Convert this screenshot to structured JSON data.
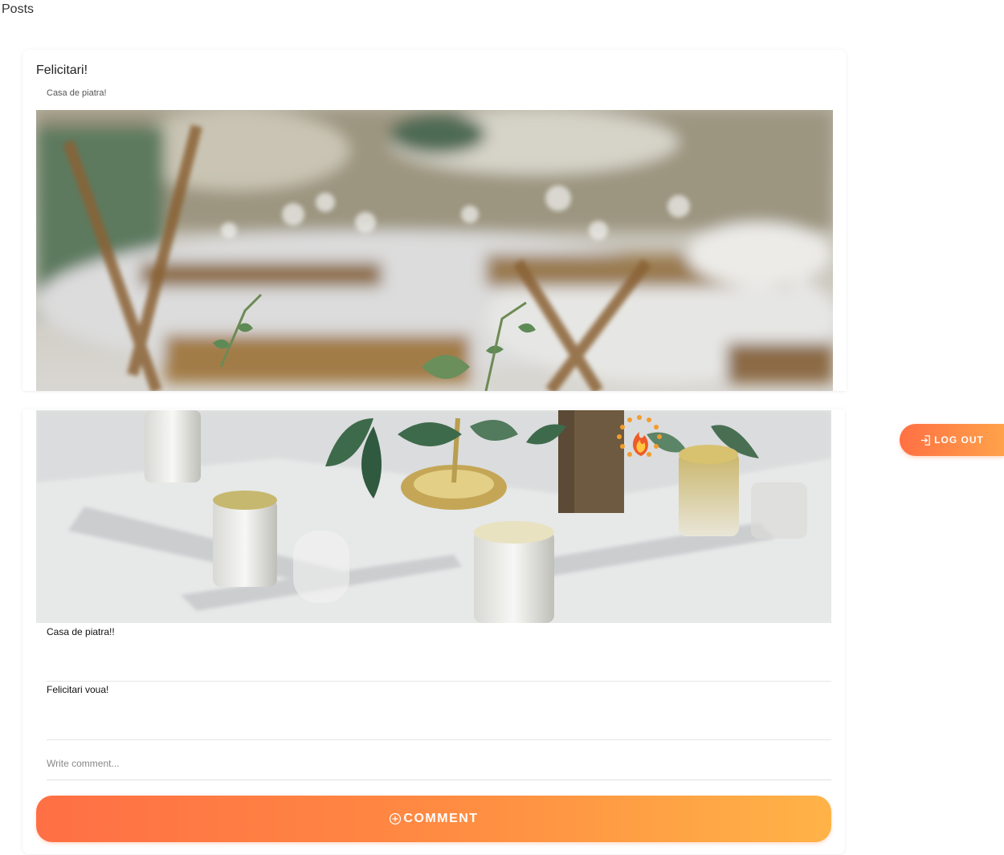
{
  "page": {
    "heading": "Posts"
  },
  "post": {
    "title": "Felicitari!",
    "subtitle": "Casa de piatra!",
    "images": [
      {
        "alt": "wedding-reception-tables"
      },
      {
        "alt": "table-centerpiece-candles"
      }
    ],
    "comments": [
      {
        "text": "Casa de piatra!!"
      },
      {
        "text": "Felicitari voua!"
      }
    ],
    "comment_input": {
      "placeholder": "Write comment...",
      "value": ""
    },
    "comment_button": {
      "label": "COMMENT",
      "icon": "plus-circle-icon"
    }
  },
  "logout_button": {
    "label": "LOG OUT",
    "icon": "login-icon"
  },
  "colors": {
    "accent_start": "#ff6f45",
    "accent_end": "#ffb347",
    "background": "#ffffff"
  }
}
